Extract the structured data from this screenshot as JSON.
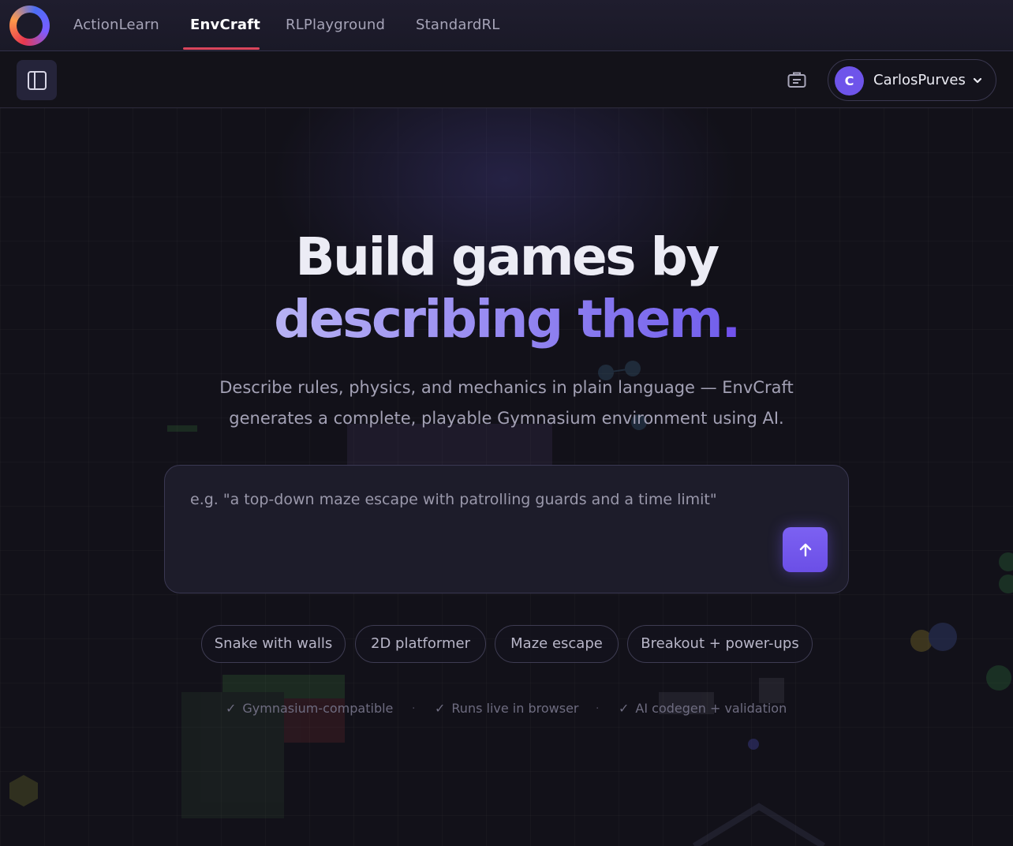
{
  "nav": {
    "logo": "app-logo",
    "tabs": [
      {
        "label": "ActionLearn",
        "active": false
      },
      {
        "label": "EnvCraft",
        "active": true
      },
      {
        "label": "RLPlayground",
        "active": false
      },
      {
        "label": "StandardRL",
        "active": false
      }
    ],
    "active_underline_color": "#d9455c"
  },
  "toolbar": {
    "sidebar_toggle_icon": "sidebar-panel-icon",
    "briefcase_icon": "briefcase-icon",
    "user": {
      "initial": "C",
      "name": "CarlosPurves",
      "avatar_color": "#6e54ea",
      "menu_icon": "chevron-down-icon"
    }
  },
  "hero": {
    "headline_line1": "Build games by",
    "headline_line2": "describing them",
    "headline_dot": ".",
    "subtitle_line1": "Describe rules, physics, and mechanics in plain language — EnvCraft",
    "subtitle_line2": "generates a complete, playable Gymnasium environment using AI.",
    "prompt": {
      "value": "",
      "placeholder": "e.g. \"a top-down maze escape with patrolling guards and a time limit\"",
      "send_icon": "arrow-up-icon"
    },
    "suggestions": [
      "Snake with walls",
      "2D platformer",
      "Maze escape",
      "Breakout + power-ups"
    ],
    "features": [
      "Gymnasium-compatible",
      "Runs live in browser",
      "AI codegen + validation"
    ],
    "accent_color": "#6e54ea"
  }
}
